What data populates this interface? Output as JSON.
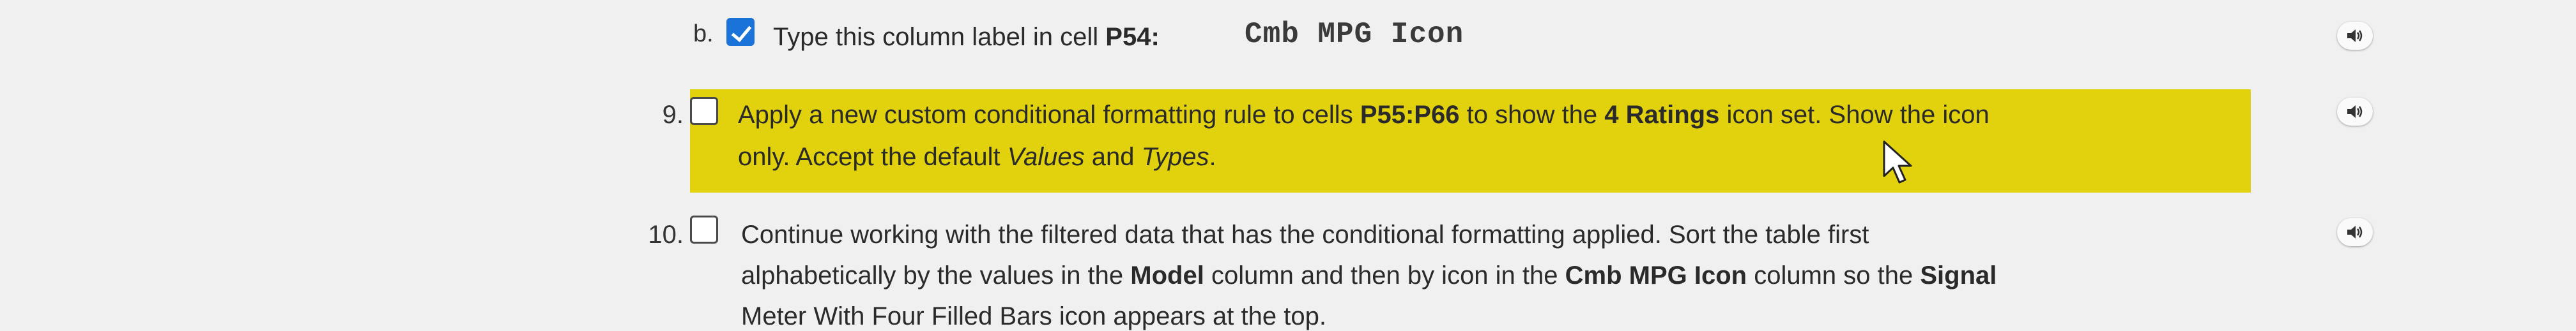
{
  "step_b": {
    "letter": "b.",
    "checked": true,
    "text_prefix": "Type this column label in cell ",
    "cell": "P54",
    "colon": ":",
    "label_value": "Cmb MPG Icon"
  },
  "step_9": {
    "number": "9.",
    "checked": false,
    "line1": {
      "t1": "Apply a new custom conditional formatting rule to cells ",
      "range": "P55:P66",
      "t2": " to show the ",
      "iconset": "4 Ratings",
      "t3": " icon set. Show the icon"
    },
    "line2": {
      "t1": "only. Accept the default ",
      "values": "Values",
      "t2": " and ",
      "types": "Types",
      "t3": "."
    }
  },
  "step_10": {
    "number": "10.",
    "checked": false,
    "line1": "Continue working with the filtered data that has the conditional formatting applied. Sort the table first",
    "line2": {
      "t1": "alphabetically by the values in the ",
      "model": "Model",
      "t2": " column and then by icon in the ",
      "icon_col": "Cmb MPG Icon",
      "t3": " column so the ",
      "signal": "Signal"
    },
    "line3_partial": "Meter With Four Filled Bars icon appears at the top."
  },
  "colors": {
    "highlight": "#e2d20e",
    "checkbox_checked": "#1a73d8",
    "background": "#f0f0f0"
  },
  "icons": {
    "audio": "speaker-icon",
    "pointer": "mouse-cursor-icon"
  }
}
